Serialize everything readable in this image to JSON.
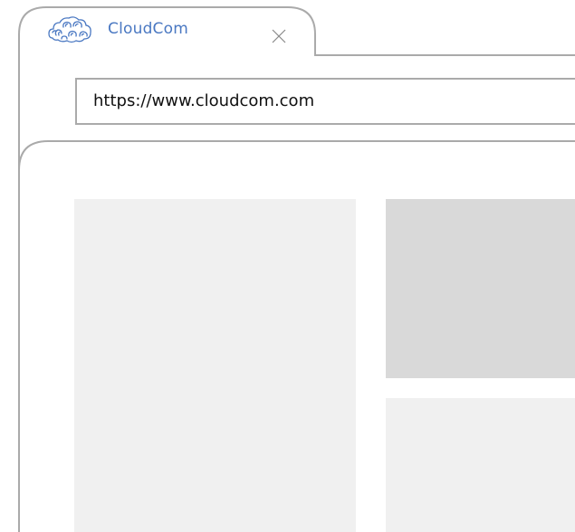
{
  "tab": {
    "title": "CloudCom",
    "logo_icon": "cloud-logo-icon",
    "close_icon": "close-icon"
  },
  "address_bar": {
    "url": "https://www.cloudcom.com"
  },
  "colors": {
    "tab_title": "#4a78c2",
    "frame_stroke": "#aaaaaa",
    "placeholder_light": "#f0f0f0",
    "placeholder_dark": "#d9d9d9"
  }
}
